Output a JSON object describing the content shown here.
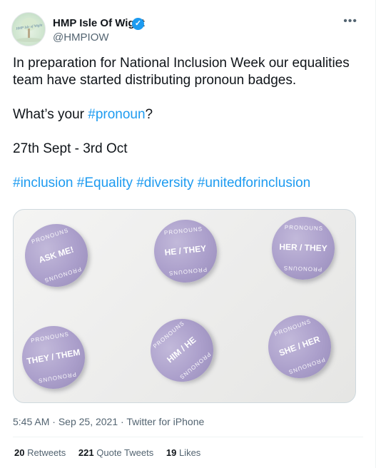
{
  "author": {
    "name": "HMP Isle Of Wight",
    "handle": "@HMPIOW",
    "verified_icon": "✓",
    "avatar_text": "HMP Isle of Wight"
  },
  "more_icon": "•••",
  "tweet": {
    "line1": "In preparation for National Inclusion Week our equalities team have started distributing pronoun badges.",
    "q_prefix": "What’s your ",
    "q_tag": "#pronoun",
    "q_suffix": "?",
    "dates": "27th Sept - 3rd Oct",
    "hashtags": [
      "#inclusion",
      "#Equality",
      "#diversity",
      "#unitedforinclusion"
    ]
  },
  "badges": [
    {
      "ring": "PRONOUNS",
      "text": "ASK ME!"
    },
    {
      "ring": "PRONOUNS",
      "text": "HE / THEY"
    },
    {
      "ring": "PRONOUNS",
      "text": "HER / THEY"
    },
    {
      "ring": "PRONOUNS",
      "text": "THEY / THEM"
    },
    {
      "ring": "PRONOUNS",
      "text": "HIM / HE"
    },
    {
      "ring": "PRONOUNS",
      "text": "SHE / HER"
    }
  ],
  "meta": {
    "time": "5:45 AM",
    "sep": " · ",
    "date": "Sep 25, 2021",
    "source": "Twitter for iPhone"
  },
  "stats": {
    "retweets_n": "20",
    "retweets_label": "Retweets",
    "quotes_n": "221",
    "quotes_label": "Quote Tweets",
    "likes_n": "19",
    "likes_label": "Likes"
  }
}
